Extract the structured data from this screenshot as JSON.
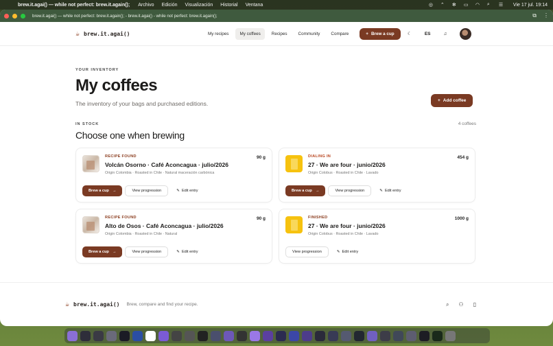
{
  "menubar": {
    "app_name": "brew.it.agai() — while not perfect: brew.it.again();",
    "menus": [
      "Archivo",
      "Edición",
      "Visualización",
      "Historial",
      "Ventana"
    ],
    "clock": "Vie 17 jul. 19:14"
  },
  "window": {
    "page_title": "brew.it.agai() — while not perfect: brew.it.again(); - brew.it.agai() - while not perfect: brew.it.again();"
  },
  "header": {
    "logo": "brew.it.agai()",
    "nav": [
      "My recipes",
      "My coffees",
      "Recipes",
      "Community",
      "Compare"
    ],
    "active_nav": "My coffees",
    "brew_button": "Brew a cup",
    "language": "ES"
  },
  "page": {
    "eyebrow": "YOUR INVENTORY",
    "title": "My coffees",
    "subtitle": "The inventory of your bags and purchased editions.",
    "add_button": "Add coffee",
    "section_eyebrow": "IN STOCK",
    "section_title": "Choose one when brewing",
    "count": "4 coffees"
  },
  "coffees": [
    {
      "status": "RECIPE FOUND",
      "name": "Volcán Osorno · Café Aconcagua · julio/2026",
      "meta": "Origin Colombia · Roasted in Chile · Natural maceración carbónica",
      "weight": "90 g",
      "thumb": "bag",
      "has_brew": true,
      "brew": "Brew a cup",
      "progression": "View progression",
      "edit": "Edit entry"
    },
    {
      "status": "DIALING IN",
      "name": "27 · We are four · junio/2026",
      "meta": "Origin Colobus · Roasted in Chile · Lavado",
      "weight": "454 g",
      "thumb": "yellow",
      "has_brew": true,
      "brew": "Brew a cup",
      "progression": "View progression",
      "edit": "Edit entry"
    },
    {
      "status": "RECIPE FOUND",
      "name": "Alto de Osos · Café Aconcagua · julio/2026",
      "meta": "Origin Colombia · Roasted in Chile · Natural",
      "weight": "90 g",
      "thumb": "bag",
      "has_brew": true,
      "brew": "Brew a cup",
      "progression": "View progression",
      "edit": "Edit entry"
    },
    {
      "status": "FINISHED",
      "name": "27 · We are four · junio/2026",
      "meta": "Origin Colobus · Roasted in Chile · Lavado",
      "weight": "1000 g",
      "thumb": "yellow",
      "has_brew": false,
      "brew": "",
      "progression": "View progression",
      "edit": "Edit entry"
    }
  ],
  "footer": {
    "logo": "brew.it.agai()",
    "tagline": "Brew, compare and find your recipe."
  },
  "colors": {
    "brand": "#7a3a23",
    "window_chrome": "#3f5a3e"
  }
}
